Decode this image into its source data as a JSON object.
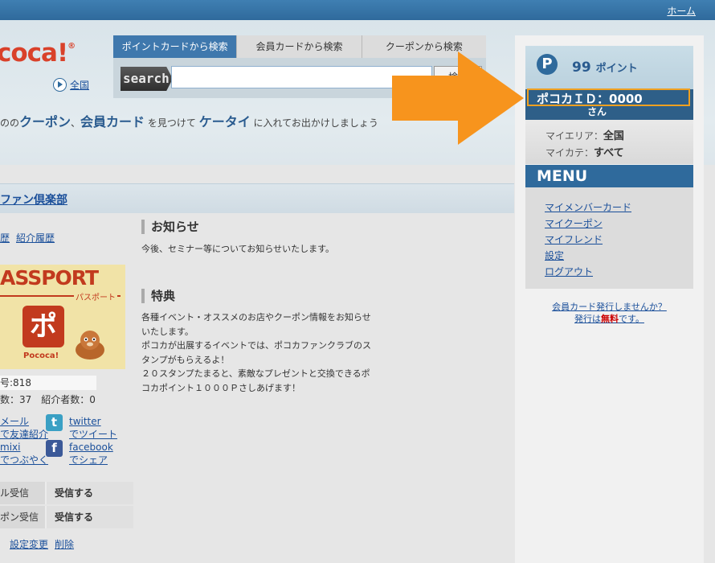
{
  "nav": {
    "home": "ホーム"
  },
  "logo": {
    "text": "coca!",
    "mark": "®"
  },
  "all_link": "全国",
  "search": {
    "tabs": [
      "ポイントカードから検索",
      "会員カードから検索",
      "クーポンから検索"
    ],
    "label": "search",
    "button": "検索",
    "placeholder": ""
  },
  "tagline": {
    "t1": "のの",
    "b1": "クーポン",
    "t2": "、",
    "b2": "会員カード",
    "t3": " を見つけて ",
    "b3": "ケータイ",
    "t4": " に入れてお出かけしましょう"
  },
  "club": {
    "title": "ファン倶楽部"
  },
  "left": {
    "history": [
      "歴",
      "紹介履歴"
    ],
    "passport": {
      "title": "ASSPORT",
      "sub": "パスポート",
      "badge": "ポ",
      "badge_sub": "Pococa!"
    },
    "member_no": "号:818",
    "counts": "数：37　紹介者数：0",
    "mail": [
      "メール",
      "で友達紹介"
    ],
    "twitter": [
      "twitter",
      "でツイート"
    ],
    "mixi": [
      "mixi",
      "でつぶやく"
    ],
    "facebook": [
      "facebook",
      "でシェア"
    ],
    "receive": [
      {
        "k": "ル受信",
        "v": "受信する"
      },
      {
        "k": "ポン受信",
        "v": "受信する"
      }
    ],
    "edit": [
      "設定変更",
      "削除"
    ]
  },
  "news": {
    "heading": "お知らせ",
    "body": "今後、セミナー等についてお知らせいたします。"
  },
  "perks": {
    "heading": "特典",
    "lines": [
      "各種イベント・オススメのお店やクーポン情報をお知らせ",
      "いたします。",
      "ポコカが出展するイベントでは、ポコカファンクラブのス",
      "タンプがもらえるよ！",
      "２０スタンプたまると、素敵なプレゼントと交換できるポ",
      "コカポイント１０００Ｐさしあげます！"
    ]
  },
  "account": {
    "p_icon": "P",
    "points_value": "99",
    "points_unit": "ポイント",
    "id_label": "ポコカＩＤ：0000",
    "san": "さん",
    "area_label": "マイエリア：",
    "area_value": "全国",
    "cate_label": "マイカテ：",
    "cate_value": "すべて"
  },
  "menu": {
    "title": "MENU",
    "items": [
      "マイメンバーカード",
      "マイクーポン",
      "マイフレンド",
      "設定",
      "ログアウト"
    ]
  },
  "issue": {
    "line1": "会員カード発行しませんか？",
    "pre": "発行は",
    "free": "無料",
    "post": "です。"
  },
  "colors": {
    "brand_blue": "#2f6a9c",
    "brand_red": "#d9412a",
    "arrow": "#f7941d"
  }
}
